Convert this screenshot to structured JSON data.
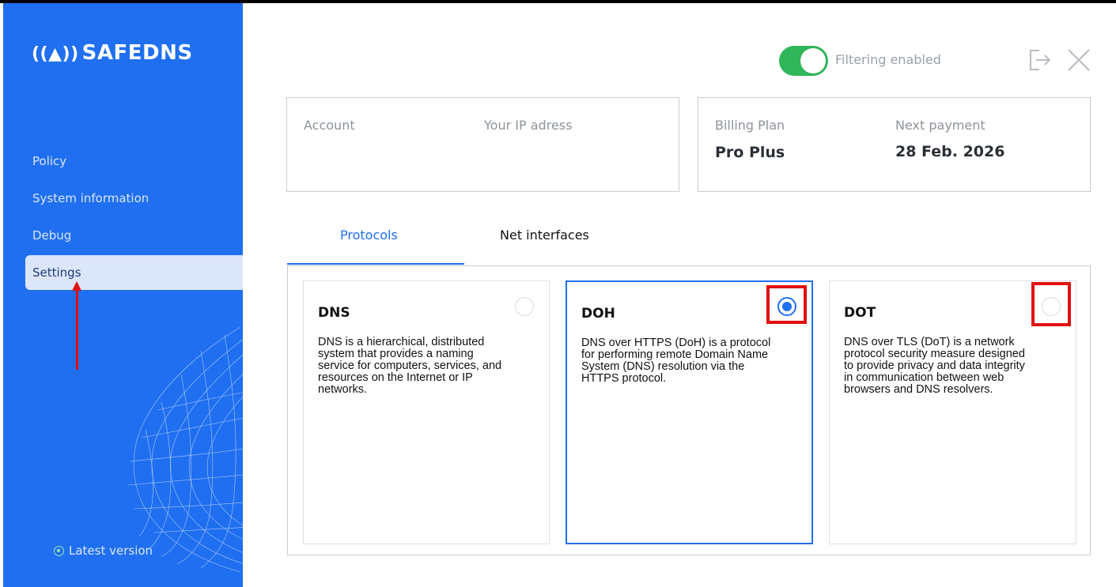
{
  "app": {
    "logo_text": "SAFEDNS",
    "accent_color": "#1f6ff0",
    "sidebar_color": "#1f6ff0",
    "toggle_color": "#2fb55a"
  },
  "sidebar": {
    "items": [
      {
        "label": "Policy",
        "active": false
      },
      {
        "label": "System information",
        "active": false
      },
      {
        "label": "Debug",
        "active": false
      },
      {
        "label": "Settings",
        "active": true
      }
    ],
    "version_status": "Latest version"
  },
  "header": {
    "filtering_enabled": true,
    "filtering_label": "Filtering enabled"
  },
  "account_card": {
    "account_label": "Account",
    "ip_label": "Your IP adress"
  },
  "billing_card": {
    "plan_label": "Billing Plan",
    "plan_value": "Pro Plus",
    "payment_label": "Next payment",
    "payment_value": "28 Feb. 2026"
  },
  "tabs": [
    {
      "label": "Protocols",
      "active": true
    },
    {
      "label": "Net interfaces",
      "active": false
    }
  ],
  "protocols": [
    {
      "title": "DNS",
      "selected": false,
      "description": "DNS is a hierarchical, distributed system that provides a naming service for computers, services, and resources on the Internet or IP networks."
    },
    {
      "title": "DOH",
      "selected": true,
      "description": "DNS over HTTPS (DoH) is a protocol for performing remote Domain Name System (DNS) resolution via the HTTPS protocol."
    },
    {
      "title": "DOT",
      "selected": false,
      "description": "DNS over TLS (DoT) is a network protocol security measure designed to provide privacy and data integrity in communication between web browsers and DNS resolvers."
    }
  ]
}
